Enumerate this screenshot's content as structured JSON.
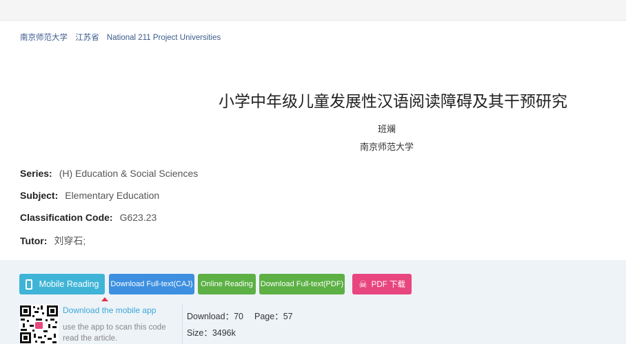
{
  "breadcrumb": {
    "school": "南京师范大学",
    "province": "江苏省",
    "category": "National 211 Project Universities"
  },
  "paper": {
    "title": "小学中年级儿童发展性汉语阅读障碍及其干预研究",
    "author": "班斓",
    "affiliation": "南京师范大学"
  },
  "meta": {
    "series_label": "Series:",
    "series_value": "(H) Education & Social Sciences",
    "subject_label": "Subject:",
    "subject_value": "Elementary Education",
    "classification_label": "Classification Code:",
    "classification_value": "G623.23",
    "tutor_label": "Tutor:",
    "tutor_value": "刘穿石;"
  },
  "actions": {
    "mobile_reading": "Mobile Reading",
    "download_caj": "Download Full-text(CAJ)",
    "online_reading": "Online Reading",
    "download_pdf": "Download Full-text(PDF)",
    "pdf_cn": "PDF 下载"
  },
  "app": {
    "link": "Download the mobile app",
    "desc": "use the app to scan this code read the article."
  },
  "stats": {
    "downloads": "Download：70",
    "pages": "Page：57",
    "size": "Size：3496k"
  },
  "colors": {
    "mobile": "#3fb4d6",
    "caj": "#3d8fe0",
    "green": "#5cb044",
    "pdf": "#e8467e"
  }
}
